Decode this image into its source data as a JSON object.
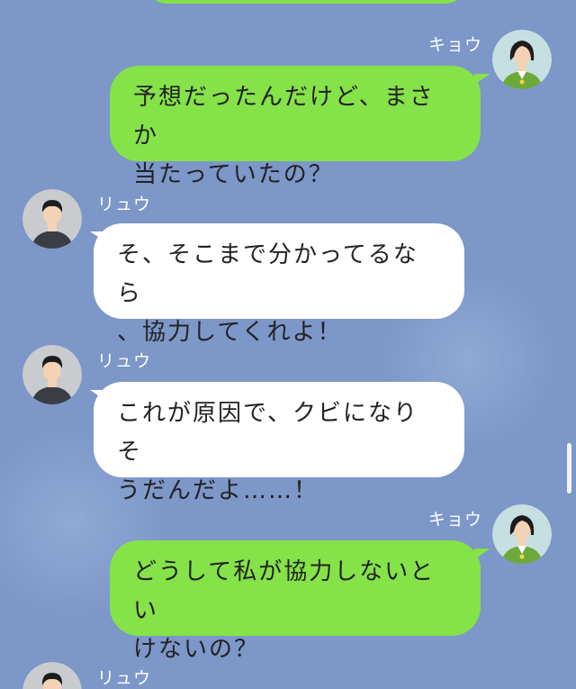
{
  "contacts": {
    "me": {
      "name": "キョウ",
      "avatar_icon": "woman-green-shirt-avatar-icon"
    },
    "other": {
      "name": "リュウ",
      "avatar_icon": "man-dark-shirt-avatar-icon"
    }
  },
  "colors": {
    "background": "#7c97c8",
    "my_bubble": "#85e249",
    "their_bubble": "#ffffff",
    "name_text": "#ffffff"
  },
  "messages": [
    {
      "sender": "キョウ",
      "side": "right",
      "text": "予想だったんだけど、まさか\n当たっていたの？"
    },
    {
      "sender": "リュウ",
      "side": "left",
      "text": "そ、そこまで分かってるなら\n、協力してくれよ！"
    },
    {
      "sender": "リュウ",
      "side": "left",
      "text": "これが原因で、クビになりそ\nうだんだよ……！"
    },
    {
      "sender": "キョウ",
      "side": "right",
      "text": "どうして私が協力しないとい\nけないの？"
    },
    {
      "sender": "リュウ",
      "side": "left",
      "text": ""
    }
  ]
}
